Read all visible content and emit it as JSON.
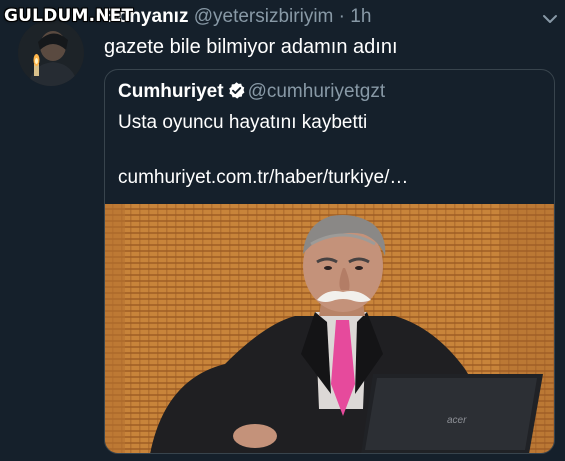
{
  "watermark": "GULDUM.NET",
  "tweet": {
    "display_name": "Bonyanız",
    "handle": "@yetersizbiriyim",
    "separator": "·",
    "time": "1h",
    "text": "gazete bile bilmiyor adamın adını",
    "menu_icon": "chevron-down-icon"
  },
  "quoted": {
    "display_name": "Cumhuriyet",
    "verified_icon": "verified-badge-icon",
    "handle": "@cumhuriyetgzt",
    "text": "Usta oyuncu hayatını kaybetti",
    "link": "cumhuriyet.com.tr/haber/turkiye/…",
    "laptop_brand": "acer"
  },
  "colors": {
    "background": "#15202b",
    "muted_text": "#8899a6",
    "border": "#38444d",
    "verified": "#ffffff"
  }
}
